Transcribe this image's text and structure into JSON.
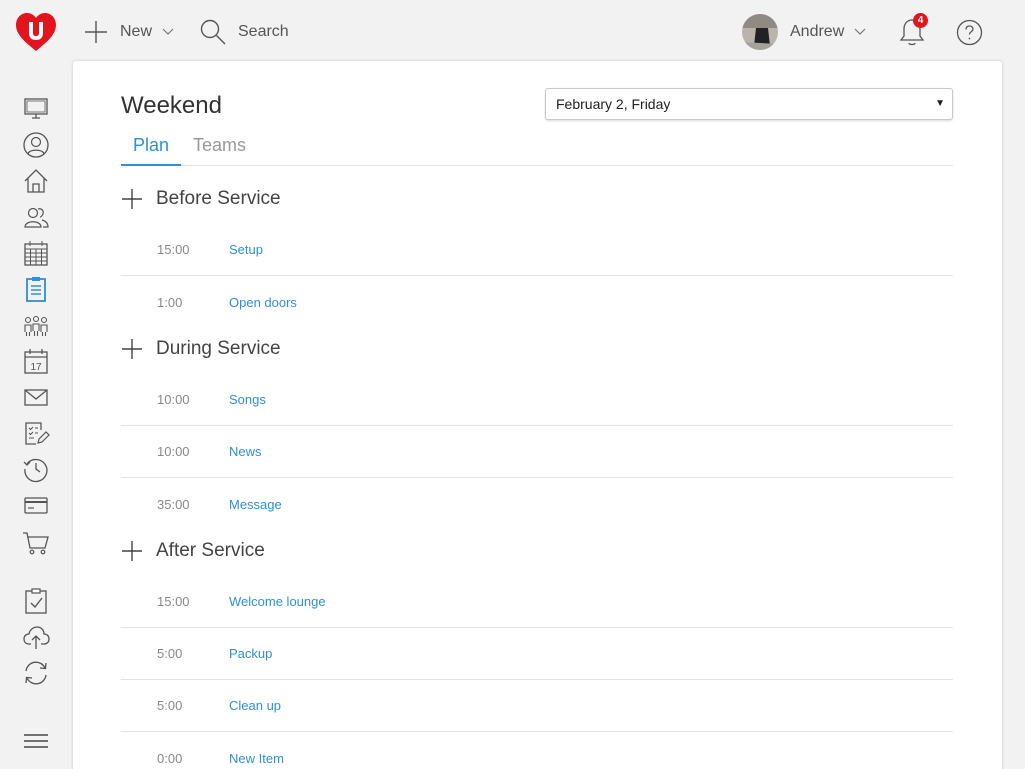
{
  "topbar": {
    "new_label": "New",
    "search_label": "Search",
    "user_name": "Andrew",
    "notification_count": "4",
    "brand_color": "#e2141d"
  },
  "sidebar": {
    "icons": [
      "monitor-icon",
      "person-icon",
      "home-icon",
      "people-icon",
      "calendar-grid-icon",
      "clipboard-icon",
      "groups-icon",
      "calendar-day-icon",
      "mail-icon",
      "checklist-edit-icon",
      "history-icon",
      "credit-card-icon",
      "cart-icon",
      "clipboard-check-icon",
      "cloud-upload-icon",
      "sync-icon",
      "menu-icon"
    ],
    "calendar_day": "17",
    "active_color": "#2f8fd8"
  },
  "page": {
    "title": "Weekend",
    "date_value": "February 2, Friday"
  },
  "tabs": {
    "plan": "Plan",
    "teams": "Teams"
  },
  "sections": [
    {
      "title": "Before Service",
      "items": [
        {
          "duration": "15:00",
          "name": "Setup"
        },
        {
          "duration": "1:00",
          "name": "Open doors"
        }
      ]
    },
    {
      "title": "During Service",
      "items": [
        {
          "duration": "10:00",
          "name": "Songs"
        },
        {
          "duration": "10:00",
          "name": "News"
        },
        {
          "duration": "35:00",
          "name": "Message"
        }
      ]
    },
    {
      "title": "After Service",
      "items": [
        {
          "duration": "15:00",
          "name": "Welcome lounge"
        },
        {
          "duration": "5:00",
          "name": "Packup"
        },
        {
          "duration": "5:00",
          "name": "Clean up"
        },
        {
          "duration": "0:00",
          "name": "New Item"
        }
      ]
    }
  ]
}
